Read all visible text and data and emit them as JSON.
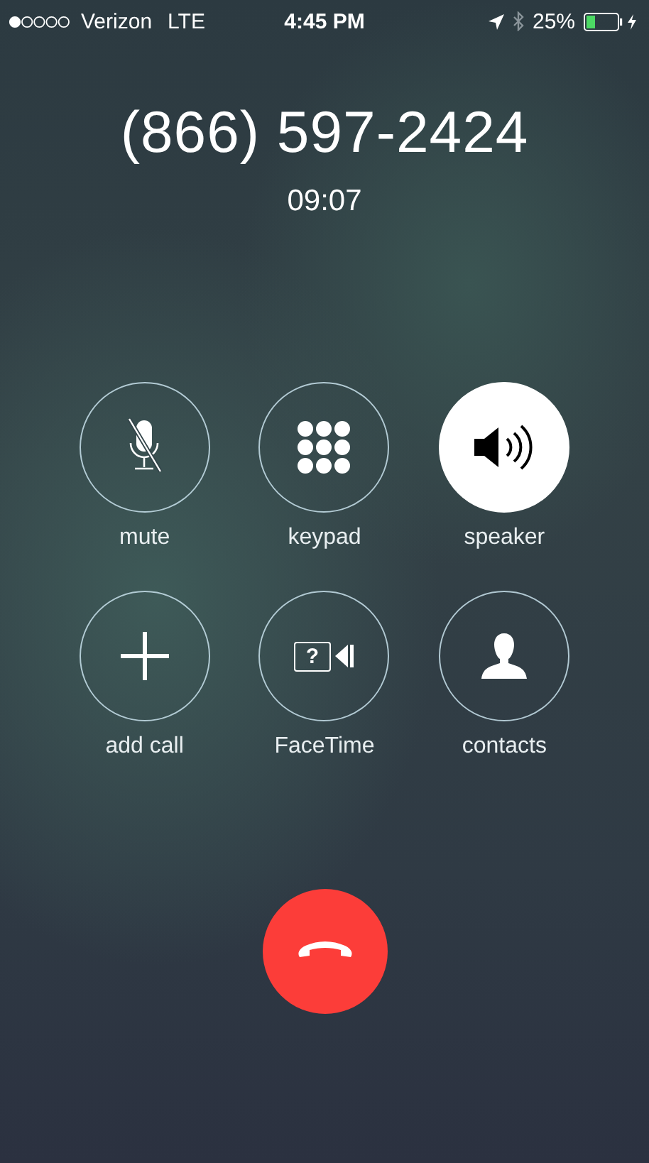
{
  "status_bar": {
    "carrier": "Verizon",
    "network": "LTE",
    "time": "4:45 PM",
    "battery_percent": "25%"
  },
  "call": {
    "number": "(866) 597-2424",
    "duration": "09:07"
  },
  "buttons": [
    {
      "kind": "mute",
      "label": "mute",
      "selected": false
    },
    {
      "kind": "keypad",
      "label": "keypad",
      "selected": false
    },
    {
      "kind": "speaker",
      "label": "speaker",
      "selected": true
    },
    {
      "kind": "add",
      "label": "add call",
      "selected": false
    },
    {
      "kind": "facetime",
      "label": "FaceTime",
      "selected": false,
      "icon_text": "?"
    },
    {
      "kind": "contacts",
      "label": "contacts",
      "selected": false
    }
  ]
}
